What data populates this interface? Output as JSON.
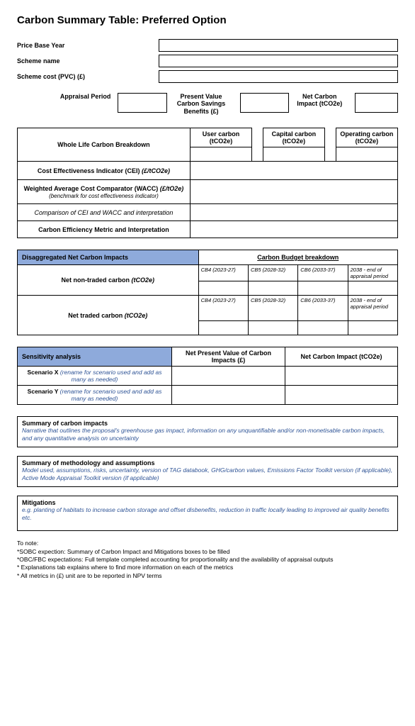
{
  "title": "Carbon Summary Table: Preferred Option",
  "form": {
    "priceBaseYearLabel": "Price Base Year",
    "schemeNameLabel": "Scheme name",
    "schemeCostLabel": "Scheme cost (PVC) (£)",
    "appraisalPeriodLabel": "Appraisal Period",
    "pvCarbonLabel": "Present Value Carbon Savings Benefits (£)",
    "netCarbonLabel": "Net Carbon Impact (tCO2e)"
  },
  "table1": {
    "wholeLifeLabel": "Whole Life Carbon Breakdown",
    "userCarbonHdr": "User carbon (tCO2e)",
    "capitalCarbonHdr": "Capital carbon (tCO2e)",
    "operatingCarbonHdr": "Operating carbon (tCO2e)",
    "ceiLabel": "Cost Effectiveness Indicator (CEI) ",
    "ceiUnit": "(£/tCO2e)",
    "waccLabel": "Weighted Average Cost Comparator (WACC) ",
    "waccUnit": "(£/tO2e)",
    "waccSub": "(benchmark for cost effectiveness indicator)",
    "comparisonLabel": "Comparison of CEI and WACC and interpretation",
    "cemLabel": "Carbon Efficiency Metric and Interpretation"
  },
  "table2": {
    "header": "Disaggregated Net Carbon Impacts",
    "cbTitle": "Carbon Budget breakdown",
    "nonTradedLabel": "Net non-traded carbon ",
    "nonTradedUnit": "(tCO2e)",
    "tradedLabel": "Net traded carbon ",
    "tradedUnit": "(tCO2e)",
    "cb4": "CB4 (2023-27)",
    "cb5": "CB5 (2028-32)",
    "cb6": "CB6 (2033-37)",
    "cbEnd": "2038 - end of appraisal period"
  },
  "table3": {
    "header": "Sensitivity analysis",
    "col1": "Net Present Value of Carbon Impacts (£)",
    "col2": "Net Carbon Impact (tCO2e)",
    "scenX": "Scenario X ",
    "scenXHint": "(rename for scenario used and add as many as needed)",
    "scenY": "Scenario Y ",
    "scenYHint": "(rename for scenario used and add as many as needed)"
  },
  "textboxes": {
    "summaryImpactsTitle": "Summary of carbon impacts",
    "summaryImpactsHint": "Narrative that outlines the proposal's greenhouse gas impact,  information on any unquantifiable and/or non-monetisable carbon impacts, and any quantitative analysis on uncertainty",
    "methodTitle": "Summary of methodology and assumptions",
    "methodHint": "Model used, assumptions, risks, uncertainty, version of TAG  databook, GHG/carbon values, Emissions Factor Toolkit version (if applicable), Active Mode Appraisal Toolkit  version (if applicable)",
    "mitigationsTitle": "Mitigations",
    "mitigationsHint": "e.g. planting of habitats to increase carbon storage and offset disbenefits, reduction in traffic locally leading to improved air quality benefits etc."
  },
  "notes": {
    "heading": "To note:",
    "n1": "*SOBC expection: Summary of Carbon Impact and Mitigations boxes to be filled",
    "n2": "*OBC/FBC expectations: Full template completed accounting for proportionality and the availability of appraisal outputs",
    "n3": "* Explanations tab explains where to find more information on each of the metrics",
    "n4": "* All metrics in (£) unit are to be reported in NPV terms"
  }
}
